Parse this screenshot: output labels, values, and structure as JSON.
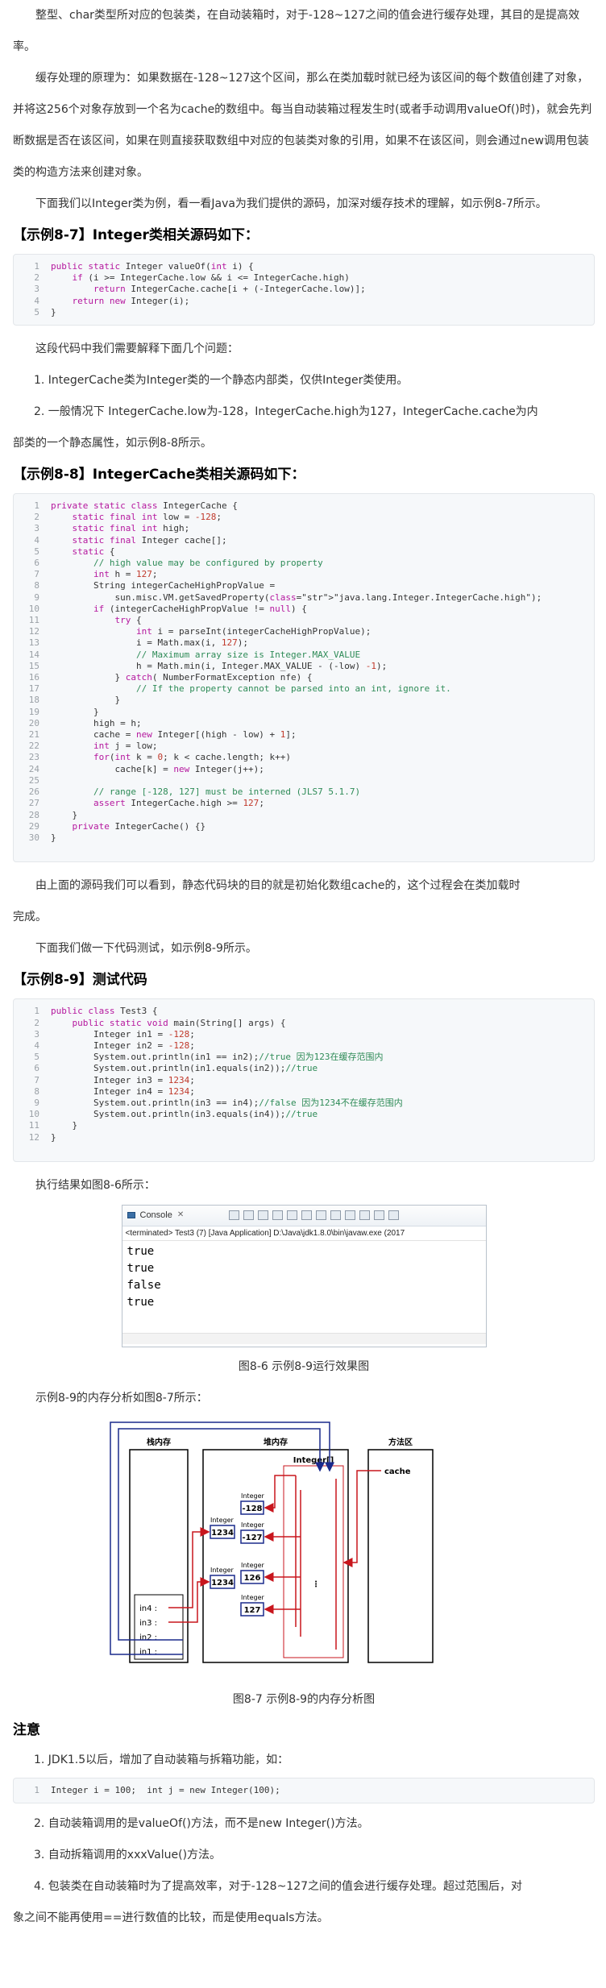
{
  "intro": {
    "p1": "整型、char类型所对应的包装类，在自动装箱时，对于-128~127之间的值会进行缓存处理，其目的是提高效率。",
    "p2": "缓存处理的原理为：如果数据在-128~127这个区间，那么在类加载时就已经为该区间的每个数值创建了对象，并将这256个对象存放到一个名为cache的数组中。每当自动装箱过程发生时(或者手动调用valueOf()时)，就会先判断数据是否在该区间，如果在则直接获取数组中对应的包装类对象的引用，如果不在该区间，则会通过new调用包装类的构造方法来创建对象。",
    "p3": "下面我们以Integer类为例，看一看Java为我们提供的源码，加深对缓存技术的理解，如示例8-7所示。"
  },
  "ex87": {
    "title": "【示例8-7】Integer类相关源码如下：",
    "lines": [
      "public static Integer valueOf(int i) {",
      "    if (i >= IntegerCache.low && i <= IntegerCache.high)",
      "        return IntegerCache.cache[i + (-IntegerCache.low)];",
      "    return new Integer(i);",
      "}"
    ]
  },
  "explain": {
    "lead": "这段代码中我们需要解释下面几个问题：",
    "item1": "1. IntegerCache类为Integer类的一个静态内部类，仅供Integer类使用。",
    "item2a": "2. 一般情况下 IntegerCache.low为-128，IntegerCache.high为127，IntegerCache.cache为内",
    "item2b": "部类的一个静态属性，如示例8-8所示。"
  },
  "ex88": {
    "title": "【示例8-8】IntegerCache类相关源码如下：",
    "lines": [
      "private static class IntegerCache {",
      "    static final int low = -128;",
      "    static final int high;",
      "    static final Integer cache[];",
      "    static {",
      "        // high value may be configured by property",
      "        int h = 127;",
      "        String integerCacheHighPropValue =",
      "            sun.misc.VM.getSavedProperty(\"java.lang.Integer.IntegerCache.high\");",
      "        if (integerCacheHighPropValue != null) {",
      "            try {",
      "                int i = parseInt(integerCacheHighPropValue);",
      "                i = Math.max(i, 127);",
      "                // Maximum array size is Integer.MAX_VALUE",
      "                h = Math.min(i, Integer.MAX_VALUE - (-low) -1);",
      "            } catch( NumberFormatException nfe) {",
      "                // If the property cannot be parsed into an int, ignore it.",
      "            }",
      "        }",
      "        high = h;",
      "        cache = new Integer[(high - low) + 1];",
      "        int j = low;",
      "        for(int k = 0; k < cache.length; k++)",
      "            cache[k] = new Integer(j++);",
      "",
      "        // range [-128, 127] must be interned (JLS7 5.1.7)",
      "        assert IntegerCache.high >= 127;",
      "    }",
      "    private IntegerCache() {}",
      "}"
    ],
    "numbers": [
      "1",
      "2",
      "3",
      "4",
      "5",
      "6",
      "7",
      "8",
      "9",
      "10",
      "11",
      "12",
      "13",
      "14",
      "15",
      "16",
      "17",
      "18",
      "19",
      "20",
      "21",
      "22",
      "23",
      "24",
      "25",
      "26",
      "27",
      "28",
      "29",
      "30",
      ""
    ]
  },
  "after88": {
    "p1a": "由上面的源码我们可以看到，静态代码块的目的就是初始化数组cache的，这个过程会在类加载时",
    "p1b": "完成。",
    "p2": "下面我们做一下代码测试，如示例8-9所示。"
  },
  "ex89": {
    "title": "【示例8-9】测试代码",
    "lines": [
      "public class Test3 {",
      "    public static void main(String[] args) {",
      "        Integer in1 = -128;",
      "        Integer in2 = -128;",
      "        System.out.println(in1 == in2);//true 因为123在缓存范围内",
      "        System.out.println(in1.equals(in2));//true",
      "        Integer in3 = 1234;",
      "        Integer in4 = 1234;",
      "        System.out.println(in3 == in4);//false 因为1234不在缓存范围内",
      "        System.out.println(in3.equals(in4));//true",
      "    }",
      "}"
    ],
    "numbers": [
      "1",
      "2",
      "3",
      "4",
      "5",
      "6",
      "7",
      "8",
      "9",
      "10",
      "11",
      "12",
      ""
    ]
  },
  "result": {
    "lead": "执行结果如图8-6所示：",
    "console_tab": "Console",
    "console_term": "<terminated> Test3 (7) [Java Application] D:\\Java\\jdk1.8.0\\bin\\javaw.exe (2017",
    "output": [
      "true",
      "true",
      "false",
      "true"
    ],
    "caption": "图8-6 示例8-9运行效果图"
  },
  "memory": {
    "lead": "示例8-9的内存分析如图8-7所示：",
    "stack_label": "栈内存",
    "heap_label": "堆内存",
    "method_label": "方法区",
    "array_label": "Integer[]",
    "cache_label": "cache",
    "vars": [
      "in4 :",
      "in3 :",
      "in2 :",
      "in1 :"
    ],
    "obj_type": "Integer",
    "obj_values": [
      "1234",
      "1234"
    ],
    "cache_values": [
      "-128",
      "-127",
      "126",
      "127"
    ],
    "dots": "·\n·\n·",
    "caption": "图8-7 示例8-9的内存分析图"
  },
  "notes": {
    "title": "注意",
    "n1": "1. JDK1.5以后，增加了自动装箱与拆箱功能，如：",
    "code": "Integer i = 100;  int j = new Integer(100);",
    "n2": "2. 自动装箱调用的是valueOf()方法，而不是new Integer()方法。",
    "n3": "3. 自动拆箱调用的xxxValue()方法。",
    "n4a": "4. 包装类在自动装箱时为了提高效率，对于-128~127之间的值会进行缓存处理。超过范围后，对",
    "n4b": "象之间不能再使用==进行数值的比较，而是使用equals方法。"
  },
  "colors": {
    "arrow_blue": "#1a2a8c",
    "arrow_red": "#c8161d",
    "keyword": "#b5179e",
    "comment": "#2e8b57"
  }
}
